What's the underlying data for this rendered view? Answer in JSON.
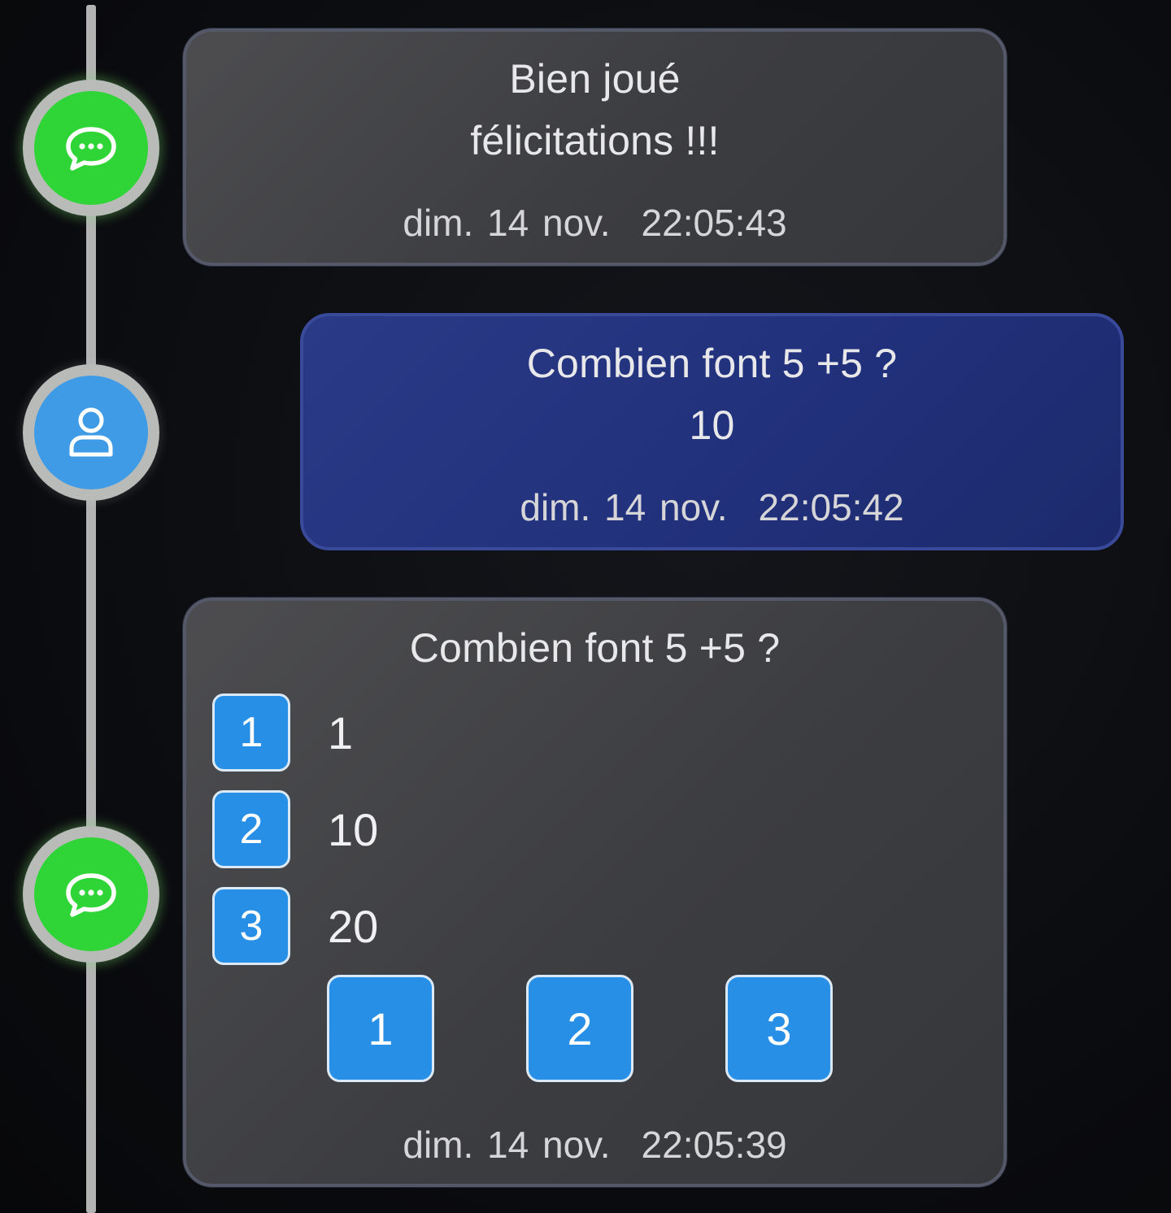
{
  "timeline": {
    "nodes": [
      {
        "type": "bot",
        "icon": "chat-bubble-icon",
        "color": "#2fd436"
      },
      {
        "type": "user",
        "icon": "user-icon",
        "color": "#3f9be6"
      },
      {
        "type": "bot",
        "icon": "chat-bubble-icon",
        "color": "#2fd436"
      }
    ]
  },
  "messages": [
    {
      "sender": "bot",
      "lines": [
        "Bien joué",
        "félicitations !!!"
      ],
      "date": "dim. 14 nov.",
      "time": "22:05:43"
    },
    {
      "sender": "user",
      "lines": [
        "Combien font 5 +5  ?",
        "10"
      ],
      "date": "dim. 14 nov.",
      "time": "22:05:42"
    },
    {
      "sender": "bot",
      "question": "Combien font 5 +5  ?",
      "options": [
        {
          "num": "1",
          "label": "1"
        },
        {
          "num": "2",
          "label": "10"
        },
        {
          "num": "3",
          "label": "20"
        }
      ],
      "buttons": [
        "1",
        "2",
        "3"
      ],
      "date": "dim. 14 nov.",
      "time": "22:05:39"
    }
  ],
  "colors": {
    "bot_bubble": "#3f4043",
    "user_bubble": "#24337c",
    "option_button": "#2790e6",
    "timeline_line": "#b3b3b3"
  }
}
